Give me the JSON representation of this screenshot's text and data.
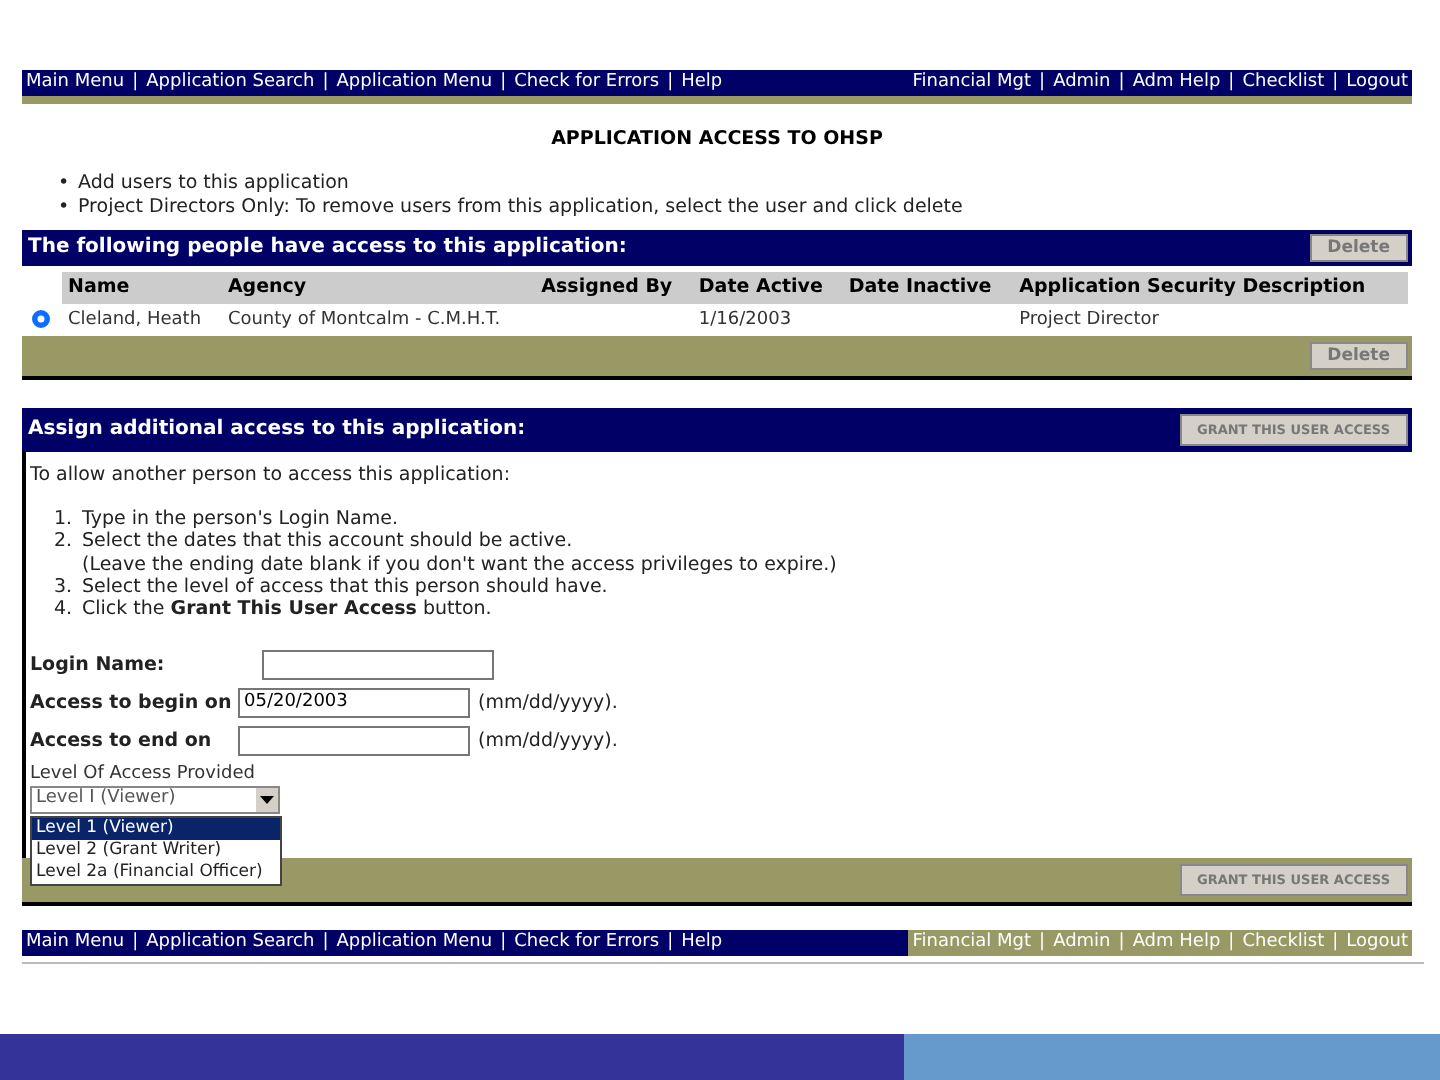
{
  "top_nav": {
    "separator": "|",
    "left_links": [
      "Main Menu",
      "Application Search",
      "Application Menu",
      "Check for Errors",
      "Help"
    ],
    "right_links": [
      "Financial Mgt",
      "Admin",
      "Adm Help",
      "Checklist",
      "Logout"
    ]
  },
  "page_title": "APPLICATION ACCESS TO OHSP",
  "notes": [
    {
      "marker": "•",
      "text": "Add users to this application"
    },
    {
      "marker": "•",
      "text": "Project Directors Only: To remove users from this application, select the user and click delete"
    }
  ],
  "access_panel": {
    "title": "The following people have access to this application:",
    "delete_buttons": [
      "Delete",
      "Delete"
    ],
    "columns": [
      "Name",
      "Agency",
      "Assigned By",
      "Date Active",
      "Date Inactive",
      "Application Security Description"
    ],
    "rows": [
      {
        "selected": true,
        "cells": [
          "Cleland, Heath",
          "County of Montcalm - C.M.H.T.",
          "",
          "1/16/2003",
          "",
          "Project Director"
        ]
      }
    ]
  },
  "assign_panel": {
    "title": "Assign additional access to this application:",
    "grant_buttons": [
      "GRANT THIS USER ACCESS",
      "GRANT THIS USER ACCESS"
    ],
    "intro": "To allow another person to access this application:",
    "steps": [
      {
        "number": "1.",
        "text": "Type in the person's Login Name."
      },
      {
        "number": "2.",
        "text": "Select the dates that this account should be active.",
        "note": "(Leave the ending date blank if you don't want the access privileges to expire.)"
      },
      {
        "number": "3.",
        "text": "Select the level of access that this person should have."
      },
      {
        "number": "4.",
        "text": "Click the **Grant This User Access** button."
      }
    ],
    "fields": [
      {
        "label": "Login Name:"
      },
      {
        "label": "Access to begin on",
        "value": "05/20/2003",
        "hint": "(mm/dd/yyyy)."
      },
      {
        "label": "Access to end on",
        "hint": "(mm/dd/yyyy)."
      }
    ],
    "level": {
      "label": "Level Of Access Provided",
      "value": "Level I (Viewer)",
      "options": [
        {
          "label": "Level 1 (Viewer)",
          "selected": true
        },
        {
          "label": "Level 2 (Grant Writer)",
          "selected": false
        },
        {
          "label": "Level 2a (Financial Officer)",
          "selected": false
        }
      ]
    }
  },
  "bottom_nav": {
    "separator": "|",
    "left_links": [
      "Main Menu",
      "Application Search",
      "Application Menu",
      "Check for Errors",
      "Help"
    ],
    "right_links": [
      "Financial Mgt",
      "Admin",
      "Adm Help",
      "Checklist",
      "Logout"
    ]
  }
}
